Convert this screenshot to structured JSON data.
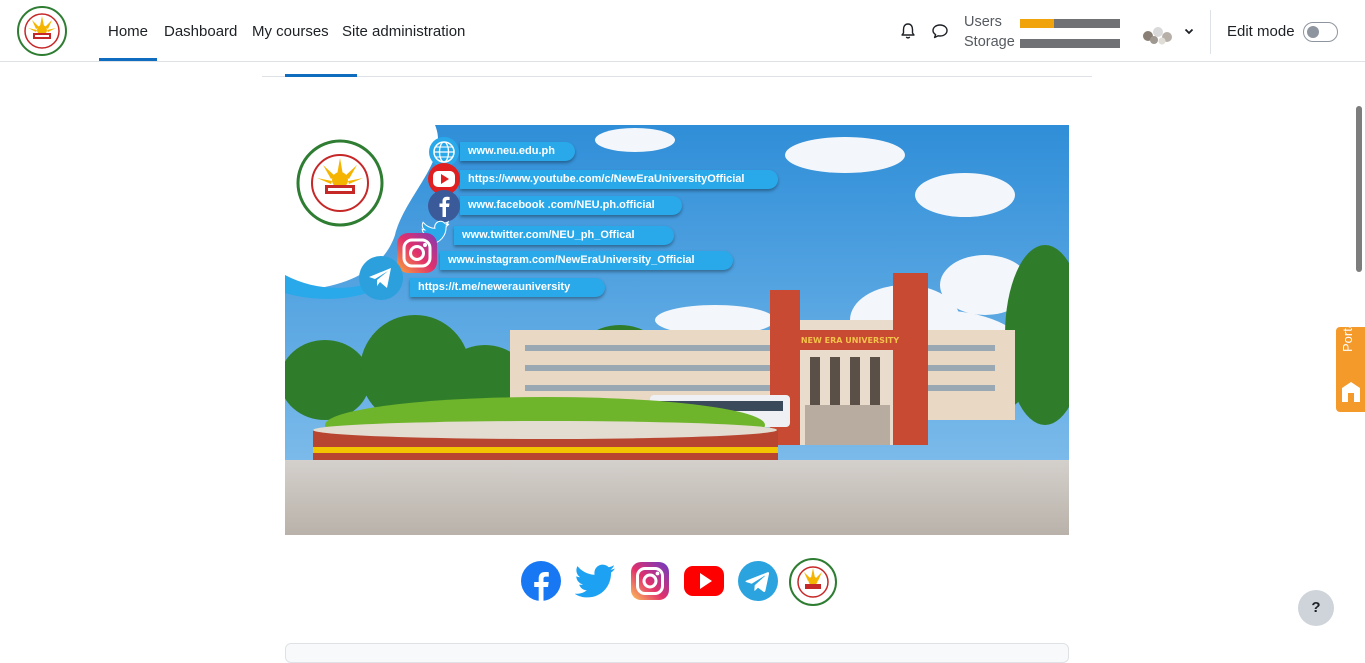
{
  "navbar": {
    "logo": "new-era-university-seal",
    "links": [
      {
        "label": "Home",
        "active": true
      },
      {
        "label": "Dashboard",
        "active": false
      },
      {
        "label": "My courses",
        "active": false
      },
      {
        "label": "Site administration",
        "active": false
      }
    ],
    "icons": [
      "bell-icon",
      "chat-icon"
    ],
    "quota": [
      {
        "label": "Users",
        "level": 0.34
      },
      {
        "label": "Storage",
        "level": 0.0
      }
    ],
    "edit_mode_label": "Edit mode",
    "edit_mode_on": false
  },
  "banner": {
    "social_links": [
      {
        "icon": "globe-icon",
        "text": "www.neu.edu.ph"
      },
      {
        "icon": "youtube-icon",
        "text": "https://www.youtube.com/c/NewEraUniversityOfficial"
      },
      {
        "icon": "facebook-icon",
        "text": "www.facebook .com/NEU.ph.official"
      },
      {
        "icon": "twitter-icon",
        "text": "www.twitter.com/NEU_ph_Offical"
      },
      {
        "icon": "instagram-icon",
        "text": "www.instagram.com/NewEraUniversity_Official"
      },
      {
        "icon": "telegram-icon",
        "text": "https://t.me/newerauniversity"
      }
    ],
    "building_sign": "NEW ERA UNIVERSITY",
    "seal_text": "NEW ERA UNIVERSITY",
    "seal_subtext": "PHILIPPINES",
    "seal_year": "1975"
  },
  "social_row": [
    "facebook-icon",
    "twitter-icon",
    "instagram-icon",
    "youtube-icon",
    "telegram-icon",
    "neu-seal-icon"
  ],
  "portal_label": "Portal",
  "help_label": "?",
  "colors": {
    "accent": "#0f6cbf",
    "pill": "#29a9ea",
    "portal": "#f39a2b"
  }
}
